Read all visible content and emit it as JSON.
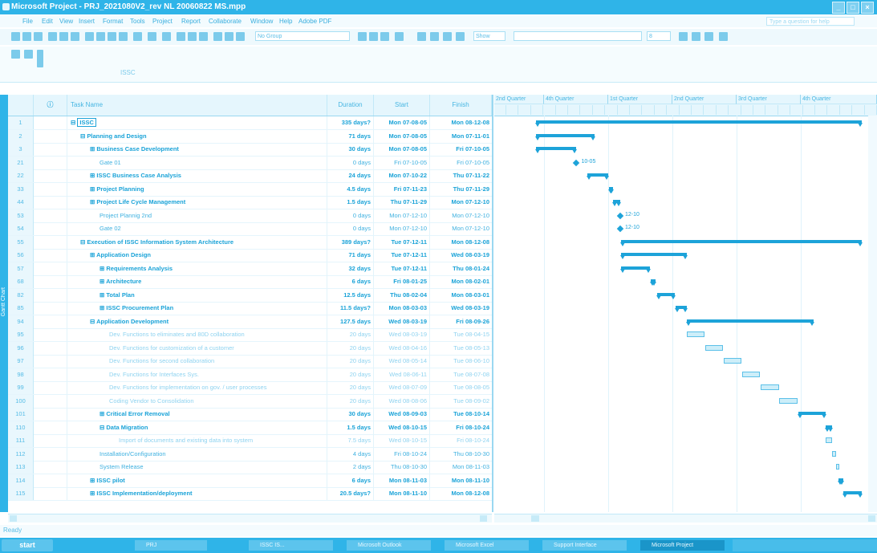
{
  "window": {
    "title": "Microsoft Project - PRJ_2021080V2_rev NL 20060822 MS.mpp"
  },
  "menu": [
    "File",
    "Edit",
    "View",
    "Insert",
    "Format",
    "Tools",
    "Project",
    "Report",
    "Collaborate",
    "Window",
    "Help",
    "Adobe PDF"
  ],
  "help_placeholder": "Type a question for help",
  "toolbar": {
    "group_select": "No Group",
    "font_size": "8",
    "show_label": "Show"
  },
  "entry_value": "ISSC",
  "side_tab": "Gantt Chart",
  "columns": {
    "id": "",
    "indicators": "",
    "name": "Task Name",
    "duration": "Duration",
    "start": "Start",
    "finish": "Finish"
  },
  "timescale": {
    "quarters": [
      "2nd Quarter",
      "4th Quarter",
      "1st Quarter",
      "2nd Quarter",
      "3rd Quarter",
      "4th Quarter"
    ]
  },
  "tasks": [
    {
      "id": "1",
      "name": "ISSC",
      "duration": "335 days?",
      "start": "Mon 07-08-05",
      "finish": "Mon 08-12-08",
      "level": 0,
      "type": "summary"
    },
    {
      "id": "2",
      "name": "Planning and Design",
      "duration": "71 days",
      "start": "Mon 07-08-05",
      "finish": "Mon 07-11-01",
      "level": 1,
      "type": "summary"
    },
    {
      "id": "3",
      "name": "Business Case Development",
      "duration": "30 days",
      "start": "Mon 07-08-05",
      "finish": "Fri 07-10-05",
      "level": 2,
      "type": "summary"
    },
    {
      "id": "21",
      "name": "Gate 01",
      "duration": "0 days",
      "start": "Fri 07-10-05",
      "finish": "Fri 07-10-05",
      "level": 3,
      "type": "milestone"
    },
    {
      "id": "22",
      "name": "ISSC Business Case Analysis",
      "duration": "24 days",
      "start": "Mon 07-10-22",
      "finish": "Thu 07-11-22",
      "level": 2,
      "type": "summary"
    },
    {
      "id": "33",
      "name": "Project Planning",
      "duration": "4.5 days",
      "start": "Fri 07-11-23",
      "finish": "Thu 07-11-29",
      "level": 2,
      "type": "summary"
    },
    {
      "id": "44",
      "name": "Project Life Cycle Management",
      "duration": "1.5 days",
      "start": "Thu 07-11-29",
      "finish": "Mon 07-12-10",
      "level": 2,
      "type": "summary"
    },
    {
      "id": "53",
      "name": "Project Plannig 2nd",
      "duration": "0 days",
      "start": "Mon 07-12-10",
      "finish": "Mon 07-12-10",
      "level": 3,
      "type": "milestone"
    },
    {
      "id": "54",
      "name": "Gate 02",
      "duration": "0 days",
      "start": "Mon 07-12-10",
      "finish": "Mon 07-12-10",
      "level": 3,
      "type": "milestone"
    },
    {
      "id": "55",
      "name": "Execution of ISSC Information System Architecture",
      "duration": "389 days?",
      "start": "Tue 07-12-11",
      "finish": "Mon 08-12-08",
      "level": 1,
      "type": "summary"
    },
    {
      "id": "56",
      "name": "Application Design",
      "duration": "71 days",
      "start": "Tue 07-12-11",
      "finish": "Wed 08-03-19",
      "level": 2,
      "type": "summary"
    },
    {
      "id": "57",
      "name": "Requirements Analysis",
      "duration": "32 days",
      "start": "Tue 07-12-11",
      "finish": "Thu 08-01-24",
      "level": 3,
      "type": "summary"
    },
    {
      "id": "68",
      "name": "Architecture",
      "duration": "6 days",
      "start": "Fri 08-01-25",
      "finish": "Mon 08-02-01",
      "level": 3,
      "type": "summary"
    },
    {
      "id": "82",
      "name": "Total Plan",
      "duration": "12.5 days",
      "start": "Thu 08-02-04",
      "finish": "Mon 08-03-01",
      "level": 3,
      "type": "summary"
    },
    {
      "id": "85",
      "name": "ISSC Procurement Plan",
      "duration": "11.5 days?",
      "start": "Mon 08-03-03",
      "finish": "Wed 08-03-19",
      "level": 3,
      "type": "summary"
    },
    {
      "id": "94",
      "name": "Application Development",
      "duration": "127.5 days",
      "start": "Wed 08-03-19",
      "finish": "Fri 08-09-26",
      "level": 2,
      "type": "summary"
    },
    {
      "id": "95",
      "name": "Dev. Functions to eliminates and 80D collaboration",
      "duration": "20 days",
      "start": "Wed 08-03-19",
      "finish": "Tue 08-04-15",
      "level": 4,
      "type": "subtle"
    },
    {
      "id": "96",
      "name": "Dev. Functions for customization of a customer",
      "duration": "20 days",
      "start": "Wed 08-04-16",
      "finish": "Tue 08-05-13",
      "level": 4,
      "type": "subtle"
    },
    {
      "id": "97",
      "name": "Dev. Functions for second collaboration",
      "duration": "20 days",
      "start": "Wed 08-05-14",
      "finish": "Tue 08-06-10",
      "level": 4,
      "type": "subtle"
    },
    {
      "id": "98",
      "name": "Dev. Functions for Interfaces Sys.",
      "duration": "20 days",
      "start": "Wed 08-06-11",
      "finish": "Tue 08-07-08",
      "level": 4,
      "type": "subtle"
    },
    {
      "id": "99",
      "name": "Dev. Functions for implementation on gov. / user processes",
      "duration": "20 days",
      "start": "Wed 08-07-09",
      "finish": "Tue 08-08-05",
      "level": 4,
      "type": "subtle"
    },
    {
      "id": "100",
      "name": "Coding Vendor to Consolidation",
      "duration": "20 days",
      "start": "Wed 08-08-06",
      "finish": "Tue 08-09-02",
      "level": 4,
      "type": "subtle"
    },
    {
      "id": "101",
      "name": "Critical Error Removal",
      "duration": "30 days",
      "start": "Wed 08-09-03",
      "finish": "Tue 08-10-14",
      "level": 3,
      "type": "summary"
    },
    {
      "id": "110",
      "name": "Data Migration",
      "duration": "1.5 days",
      "start": "Wed 08-10-15",
      "finish": "Fri 08-10-24",
      "level": 3,
      "type": "summary-open"
    },
    {
      "id": "111",
      "name": "Import of documents and existing data into system",
      "duration": "7.5 days",
      "start": "Wed 08-10-15",
      "finish": "Fri 08-10-24",
      "level": 5,
      "type": "subtle"
    },
    {
      "id": "112",
      "name": "Installation/Configuration",
      "duration": "4 days",
      "start": "Fri 08-10-24",
      "finish": "Thu 08-10-30",
      "level": 3,
      "type": "normal"
    },
    {
      "id": "113",
      "name": "System Release",
      "duration": "2 days",
      "start": "Thu 08-10-30",
      "finish": "Mon 08-11-03",
      "level": 3,
      "type": "normal"
    },
    {
      "id": "114",
      "name": "ISSC pilot",
      "duration": "6 days",
      "start": "Mon 08-11-03",
      "finish": "Mon 08-11-10",
      "level": 2,
      "type": "summary"
    },
    {
      "id": "115",
      "name": "ISSC Implementation/deployment",
      "duration": "20.5 days?",
      "start": "Mon 08-11-10",
      "finish": "Mon 08-12-08",
      "level": 2,
      "type": "summary"
    }
  ],
  "milestone_labels": [
    "10-05",
    "12-10",
    "12-10"
  ],
  "status": {
    "text": "Ready"
  },
  "taskbar": {
    "start": "start",
    "items": [
      "PRJ",
      "ISSC IS...",
      "Microsoft Outlook",
      "Microsoft Excel",
      "Support Interface",
      "Microsoft Project"
    ]
  }
}
